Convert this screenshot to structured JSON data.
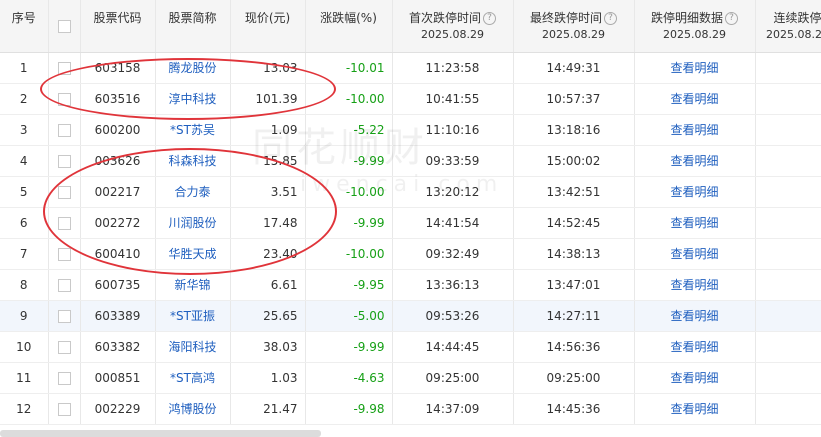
{
  "headers": {
    "seq": "序号",
    "code": "股票代码",
    "name": "股票简称",
    "price": "现价(元)",
    "change": "涨跌幅(%)",
    "first_time": "首次跌停时间",
    "last_time": "最终跌停时间",
    "detail": "跌停明细数据",
    "consecutive": "连续跌停",
    "date": "2025.08.29"
  },
  "watermark": {
    "text": "同花顺财",
    "domain": "iwencai.com"
  },
  "rows": [
    {
      "seq": "1",
      "code": "603158",
      "name": "腾龙股份",
      "price": "13.03",
      "change": "-10.01",
      "first": "11:23:58",
      "last": "14:49:31",
      "detail": "查看明细"
    },
    {
      "seq": "2",
      "code": "603516",
      "name": "淳中科技",
      "price": "101.39",
      "change": "-10.00",
      "first": "10:41:55",
      "last": "10:57:37",
      "detail": "查看明细"
    },
    {
      "seq": "3",
      "code": "600200",
      "name": "*ST苏吴",
      "price": "1.09",
      "change": "-5.22",
      "first": "11:10:16",
      "last": "13:18:16",
      "detail": "查看明细"
    },
    {
      "seq": "4",
      "code": "003626",
      "name": "科森科技",
      "price": "15.85",
      "change": "-9.99",
      "first": "09:33:59",
      "last": "15:00:02",
      "detail": "查看明细"
    },
    {
      "seq": "5",
      "code": "002217",
      "name": "合力泰",
      "price": "3.51",
      "change": "-10.00",
      "first": "13:20:12",
      "last": "13:42:51",
      "detail": "查看明细"
    },
    {
      "seq": "6",
      "code": "002272",
      "name": "川润股份",
      "price": "17.48",
      "change": "-9.99",
      "first": "14:41:54",
      "last": "14:52:45",
      "detail": "查看明细"
    },
    {
      "seq": "7",
      "code": "600410",
      "name": "华胜天成",
      "price": "23.40",
      "change": "-10.00",
      "first": "09:32:49",
      "last": "14:38:13",
      "detail": "查看明细"
    },
    {
      "seq": "8",
      "code": "600735",
      "name": "新华锦",
      "price": "6.61",
      "change": "-9.95",
      "first": "13:36:13",
      "last": "13:47:01",
      "detail": "查看明细"
    },
    {
      "seq": "9",
      "code": "603389",
      "name": "*ST亚振",
      "price": "25.65",
      "change": "-5.00",
      "first": "09:53:26",
      "last": "14:27:11",
      "detail": "查看明细"
    },
    {
      "seq": "10",
      "code": "603382",
      "name": "海阳科技",
      "price": "38.03",
      "change": "-9.99",
      "first": "14:44:45",
      "last": "14:56:36",
      "detail": "查看明细"
    },
    {
      "seq": "11",
      "code": "000851",
      "name": "*ST高鸿",
      "price": "1.03",
      "change": "-4.63",
      "first": "09:25:00",
      "last": "09:25:00",
      "detail": "查看明细"
    },
    {
      "seq": "12",
      "code": "002229",
      "name": "鸿博股份",
      "price": "21.47",
      "change": "-9.98",
      "first": "14:37:09",
      "last": "14:45:36",
      "detail": "查看明细"
    }
  ],
  "colors": {
    "negative": "#16a016",
    "link": "#1f5fbf",
    "annotation": "#e0343a",
    "header_bg": "#f5f5f5",
    "highlight_row": "#f2f6fc"
  }
}
